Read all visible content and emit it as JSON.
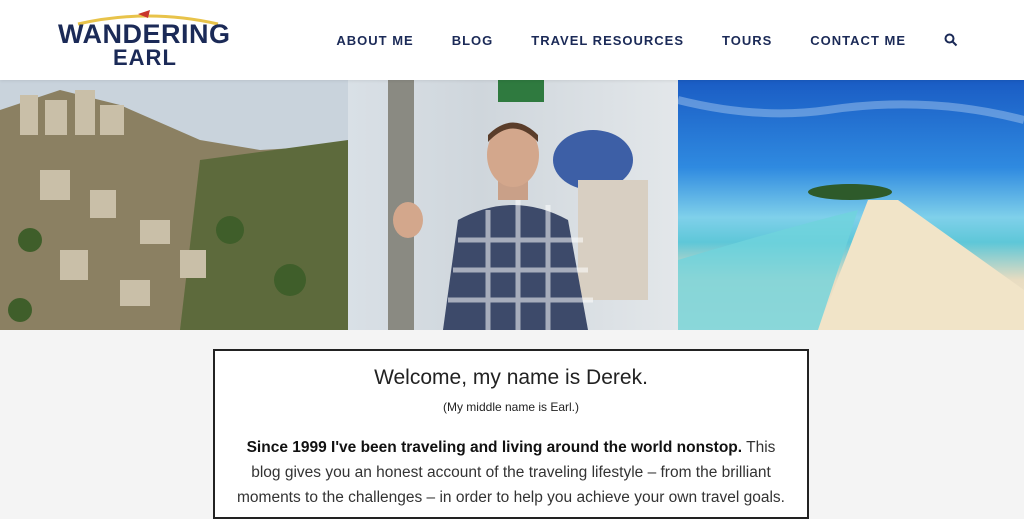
{
  "header": {
    "logo_top": "WANDERING",
    "logo_bottom": "EARL",
    "nav": [
      "ABOUT ME",
      "BLOG",
      "TRAVEL RESOURCES",
      "TOURS",
      "CONTACT ME"
    ]
  },
  "banner": {
    "images": [
      "hillside-village-photo",
      "man-in-plaid-shirt-photo",
      "tropical-beach-sandbar-photo"
    ]
  },
  "welcome": {
    "title": "Welcome, my name is Derek.",
    "subtitle": "(My middle name is Earl.)",
    "body_bold": "Since 1999 I've been traveling and living around the world nonstop.",
    "body_text": " This blog gives you an honest account of the traveling lifestyle – from the brilliant moments to the challenges – in order to help you achieve your own travel goals."
  },
  "colors": {
    "brand": "#1b2a57",
    "accent": "#e8c34a",
    "logo_red": "#c8352b"
  }
}
